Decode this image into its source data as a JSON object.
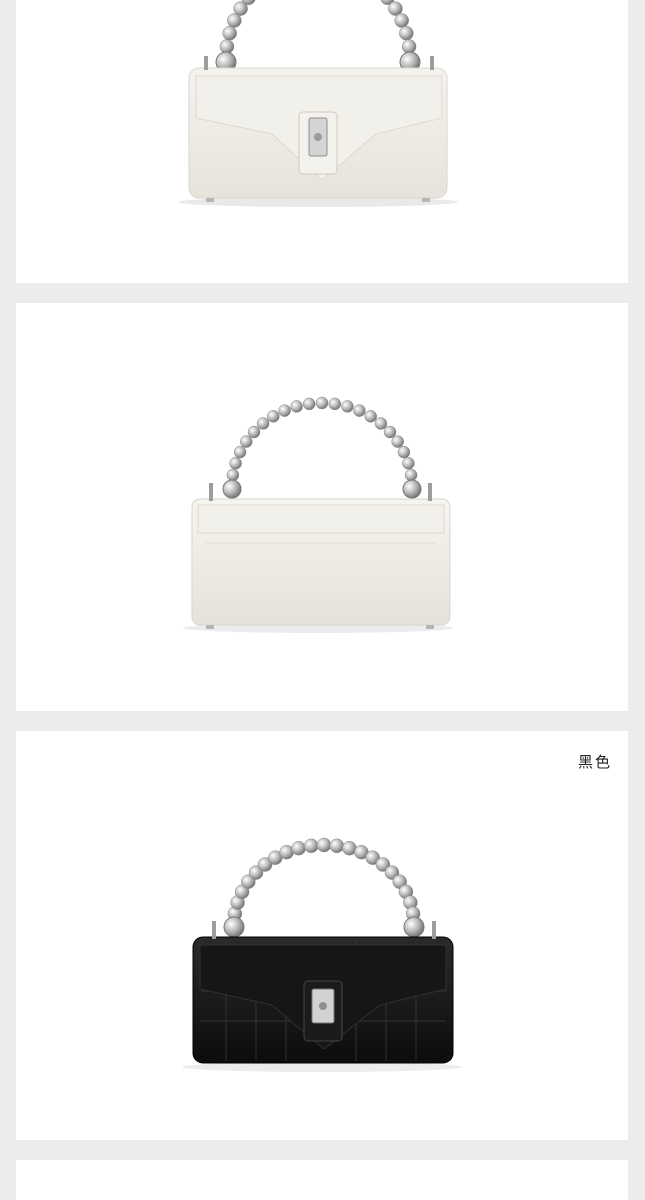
{
  "gallery": {
    "items": [
      {
        "color_name": "",
        "bag_color": "#efede6",
        "handle_color": "#c9c9c9"
      },
      {
        "color_name": "",
        "bag_color": "#efede6",
        "handle_color": "#c9c9c9"
      },
      {
        "color_name": "黑色",
        "bag_color": "#151515",
        "handle_color": "#c9c9c9"
      },
      {
        "color_name": ""
      }
    ]
  }
}
